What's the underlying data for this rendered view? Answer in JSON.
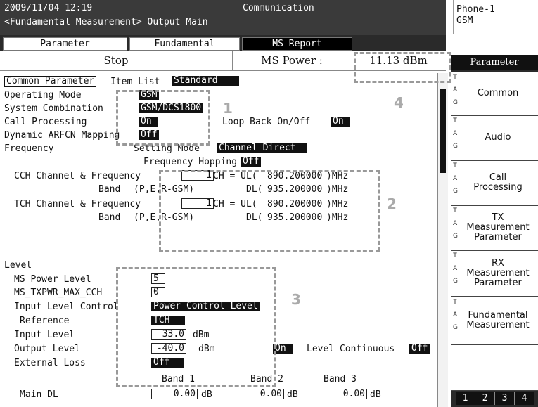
{
  "header": {
    "datetime": "2009/11/04 12:19",
    "mode": "Communication",
    "breadcrumb": "<Fundamental Measurement> Output Main",
    "phone": "Phone-1",
    "system": "GSM"
  },
  "tabs": [
    {
      "label": "Parameter"
    },
    {
      "label": "Fundamental"
    },
    {
      "label": "MS Report"
    }
  ],
  "status": {
    "state": "Stop",
    "ms_power_label": "MS Power :",
    "ms_power_value": "11.13 dBm"
  },
  "sidepanel": {
    "header": "Parameter",
    "tag_letters": [
      "T",
      "A",
      "G"
    ],
    "buttons": [
      {
        "label": "Common"
      },
      {
        "label": "Audio"
      },
      {
        "label": "Call Processing"
      },
      {
        "label": "TX Measurement Parameter"
      },
      {
        "label": "RX Measurement Parameter"
      },
      {
        "label": "Fundamental Measurement"
      }
    ],
    "pages": [
      "1",
      "2",
      "3",
      "4"
    ]
  },
  "common": {
    "tab_label": "Common Parameter",
    "item_list_label": "Item List",
    "item_list_value": "Standard",
    "operating_mode_label": "Operating Mode",
    "operating_mode_value": "GSM",
    "system_combination_label": "System Combination",
    "system_combination_value": "GSM/DCS1800",
    "call_processing_label": "Call Processing",
    "call_processing_value": "On",
    "loop_back_label": "Loop Back On/Off",
    "loop_back_value": "On",
    "dynamic_arfcn_label": "Dynamic ARFCN Mapping",
    "dynamic_arfcn_value": "Off"
  },
  "frequency": {
    "label": "Frequency",
    "setting_mode_label": "Setting Mode",
    "setting_mode_value": "Channel Direct",
    "hopping_label": "Frequency Hopping",
    "hopping_value": "Off",
    "cch_label": "CCH Channel & Frequency",
    "cch_channel": "1",
    "band_label": "Band",
    "cch_band": "(P,E,R-GSM)",
    "ch_ul_label": "CH = UL(",
    "cch_ul": "890.200000",
    "dl_label": "DL(",
    "cch_dl": "935.200000",
    "mhz": ")MHz",
    "tch_label": "TCH Channel & Frequency",
    "tch_channel": "1",
    "tch_band": "(P,E,R-GSM)",
    "tch_ul": "890.200000",
    "tch_dl": "935.200000"
  },
  "level": {
    "label": "Level",
    "ms_power_level_label": "MS Power Level",
    "ms_power_level_value": "5",
    "ms_txpwr_label": "MS_TXPWR_MAX_CCH",
    "ms_txpwr_value": "0",
    "input_level_control_label": "Input Level Control",
    "input_level_control_value": "Power Control Level",
    "reference_label": "Reference",
    "reference_value": "TCH",
    "input_level_label": "Input Level",
    "input_level_value": "33.0",
    "output_level_label": "Output Level",
    "output_level_value": "-40.0",
    "dbm": "dBm",
    "output_on_value": "On",
    "level_continuous_label": "Level Continuous",
    "level_continuous_value": "Off",
    "external_loss_label": "External Loss",
    "external_loss_value": "Off",
    "band1": "Band 1",
    "band2": "Band 2",
    "band3": "Band 3",
    "main_dl_label": "Main DL",
    "main_dl_b1": "0.00",
    "main_dl_b2": "0.00",
    "main_dl_b3": "0.00",
    "db": "dB"
  },
  "callouts": [
    "1",
    "2",
    "3",
    "4"
  ]
}
